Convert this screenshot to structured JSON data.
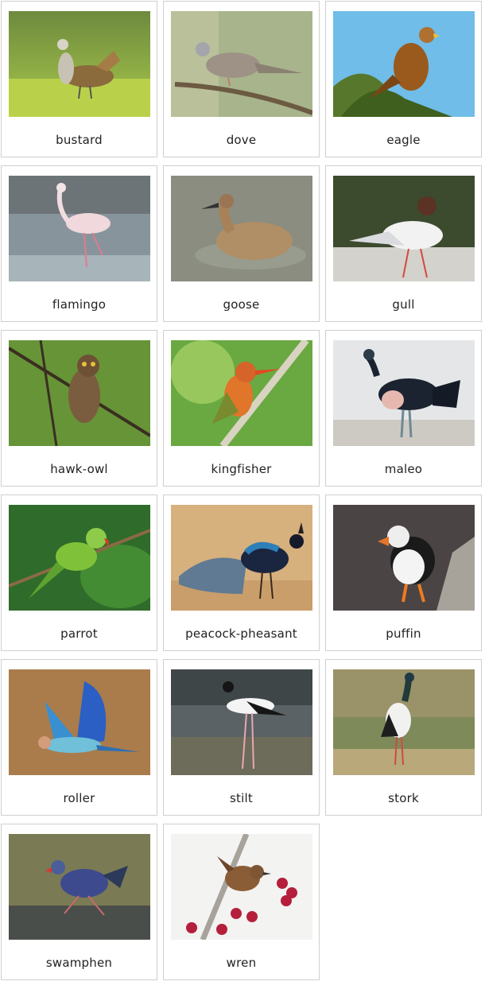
{
  "cards": [
    {
      "label": "bustard"
    },
    {
      "label": "dove"
    },
    {
      "label": "eagle"
    },
    {
      "label": "flamingo"
    },
    {
      "label": "goose"
    },
    {
      "label": "gull"
    },
    {
      "label": "hawk-owl"
    },
    {
      "label": "kingfisher"
    },
    {
      "label": "maleo"
    },
    {
      "label": "parrot"
    },
    {
      "label": "peacock-pheasant"
    },
    {
      "label": "puffin"
    },
    {
      "label": "roller"
    },
    {
      "label": "stilt"
    },
    {
      "label": "stork"
    },
    {
      "label": "swamphen"
    },
    {
      "label": "wren"
    }
  ]
}
